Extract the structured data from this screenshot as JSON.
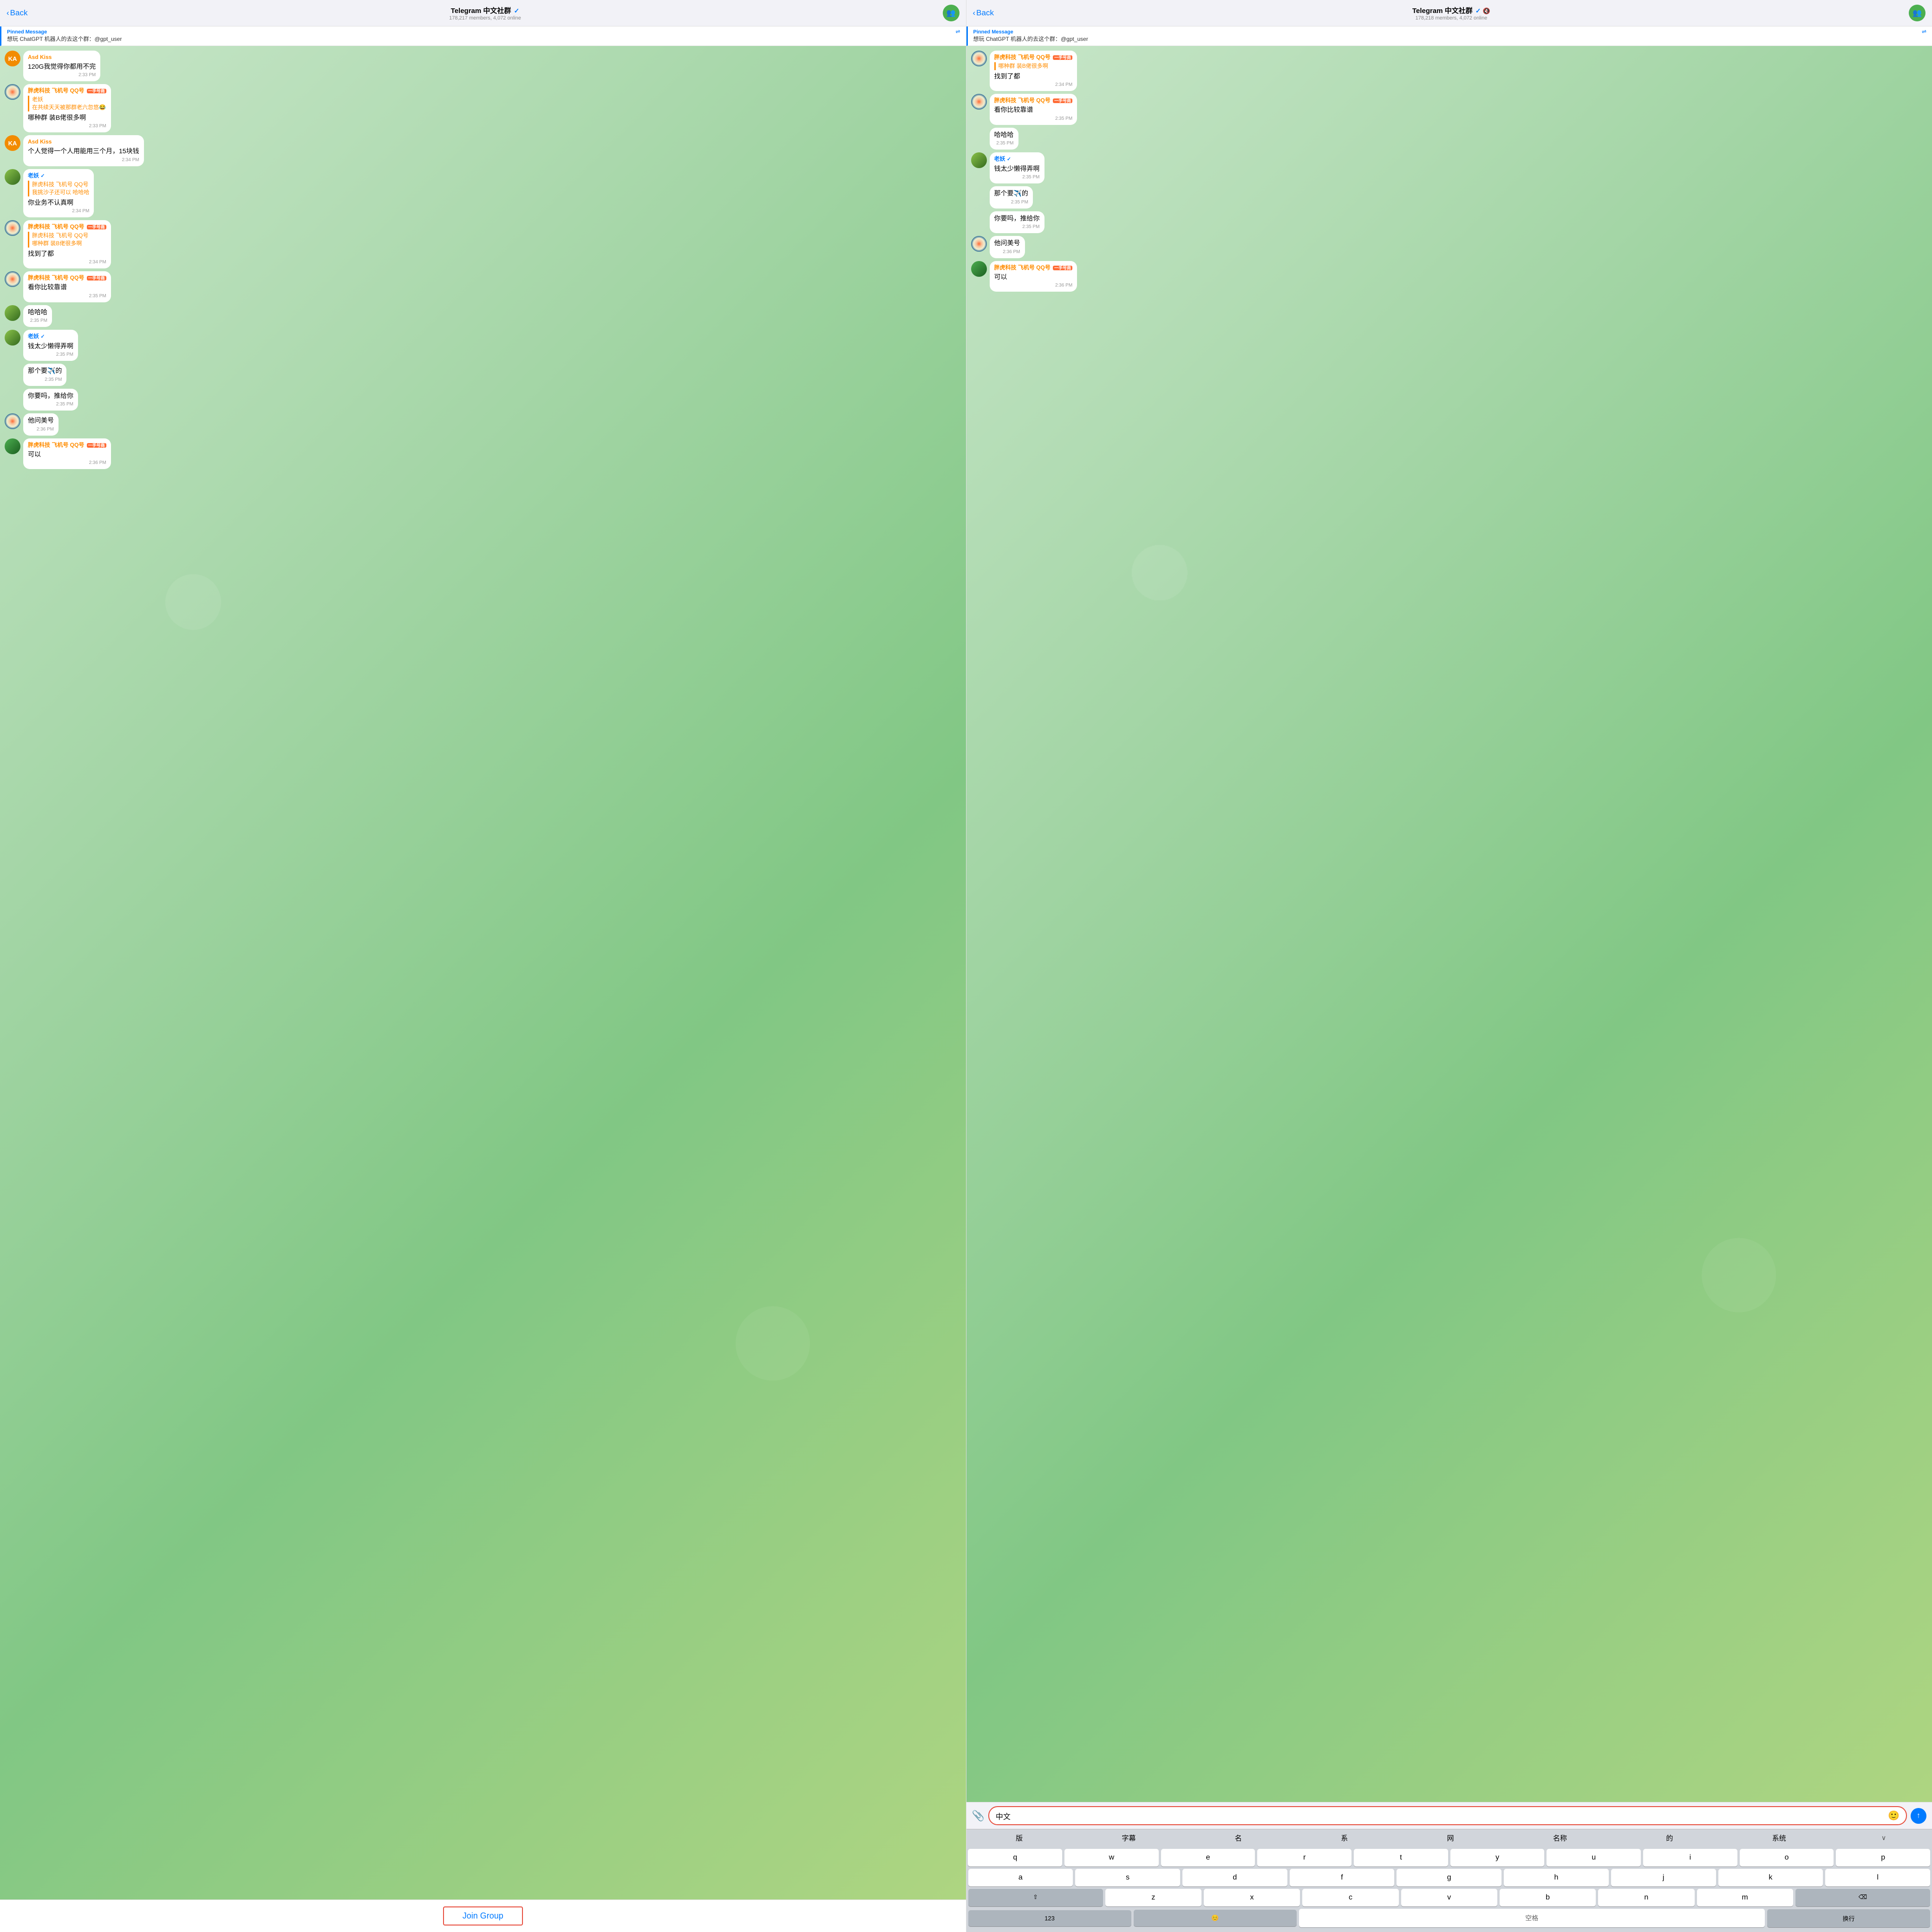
{
  "left_panel": {
    "header": {
      "back_label": "Back",
      "title": "Telegram 中文社群",
      "verified": true,
      "subtitle": "178,217 members, 4,072 online"
    },
    "pinned": {
      "label": "Pinned Message",
      "text": "想玩 ChatGPT 机器人的去这个群：@gpt_user"
    },
    "messages": [
      {
        "id": "m1",
        "avatar": "KA",
        "avatar_type": "ka",
        "sender": "Asd Kiss",
        "sender_color": "orange",
        "text": "120G我觉得你都用不完",
        "time": "2:33 PM"
      },
      {
        "id": "m2",
        "avatar": "deco",
        "avatar_type": "deco",
        "sender": "胖虎科技 飞机号 QQ号",
        "sender_color": "orange",
        "badge": true,
        "quote": "老妖",
        "quote_text": "在共续天天被那群老六忽悠😂",
        "text": "哪种群 装B佬很多啊",
        "time": "2:33 PM"
      },
      {
        "id": "m3",
        "avatar": "KA",
        "avatar_type": "ka",
        "sender": "Asd Kiss",
        "sender_color": "orange",
        "text": "个人觉得一个人用能用三个月，15块钱",
        "time": "2:34 PM"
      },
      {
        "id": "m4",
        "avatar": "verified",
        "avatar_type": "photo",
        "sender": "老妖",
        "sender_color": "blue",
        "verified": true,
        "quote": "胖虎科技 飞机号 QQ号",
        "quote_text": "我挑沙子还可以 哈哈哈",
        "text": "你业务不认真啊",
        "time": "2:34 PM"
      },
      {
        "id": "m5",
        "avatar": "deco",
        "avatar_type": "deco",
        "sender": "胖虎科技 飞机号 QQ号",
        "sender_color": "orange",
        "badge": true,
        "quote": "胖虎科技 飞机号 QQ号",
        "quote_text": "哪种群 装B佬很多啊",
        "text": "找到了都",
        "time": "2:34 PM"
      },
      {
        "id": "m6",
        "avatar": "deco",
        "avatar_type": "deco",
        "sender": "胖虎科技 飞机号 QQ号",
        "sender_color": "orange",
        "badge": true,
        "text": "看你比较靠谱",
        "time": "2:35 PM"
      },
      {
        "id": "m7",
        "avatar": null,
        "text": "哈哈哈",
        "time": "2:35 PM",
        "no_sender": true
      },
      {
        "id": "m8",
        "avatar": "verified",
        "avatar_type": "photo",
        "sender": "老妖",
        "sender_color": "blue",
        "verified": true,
        "text": "钱太少懒得弄啊",
        "time": "2:35 PM"
      },
      {
        "id": "m9",
        "avatar": null,
        "text": "那个要✈️的",
        "time": "2:35 PM",
        "no_sender": true
      },
      {
        "id": "m10",
        "avatar": null,
        "text": "你要吗，推给你",
        "time": "2:35 PM",
        "no_sender": true
      },
      {
        "id": "m11",
        "avatar": "deco",
        "avatar_type": "deco",
        "text": "他问美号",
        "time": "2:36 PM",
        "no_sender": true
      },
      {
        "id": "m12",
        "avatar": "deco",
        "avatar_type": "deco2",
        "sender": "胖虎科技 飞机号 QQ号",
        "sender_color": "orange",
        "badge": true,
        "text": "可以",
        "time": "2:36 PM"
      }
    ],
    "join_button": "Join Group"
  },
  "right_panel": {
    "header": {
      "back_label": "Back",
      "title": "Telegram 中文社群",
      "verified": true,
      "muted": true,
      "subtitle": "178,218 members, 4,072 online"
    },
    "pinned": {
      "label": "Pinned Message",
      "text": "想玩 ChatGPT 机器人的去这个群：@gpt_user"
    },
    "messages": [
      {
        "id": "r1",
        "avatar": "deco",
        "sender": "胖虎科技 飞机号 QQ号",
        "sender_color": "orange",
        "badge": true,
        "quote": "哪种群 装B佬很多啊",
        "text": "找到了都",
        "time": "2:34 PM"
      },
      {
        "id": "r2",
        "avatar": "deco",
        "sender": "胖虎科技 飞机号 QQ号",
        "sender_color": "orange",
        "badge": true,
        "text": "看你比较靠谱",
        "time": "2:35 PM"
      },
      {
        "id": "r3",
        "text": "哈哈哈",
        "time": "2:35 PM",
        "no_sender": true
      },
      {
        "id": "r4",
        "avatar": "photo",
        "sender": "老妖",
        "sender_color": "blue",
        "verified": true,
        "text": "钱太少懒得弄啊",
        "time": "2:35 PM"
      },
      {
        "id": "r5",
        "text": "那个要✈️的",
        "time": "2:35 PM",
        "no_sender": true
      },
      {
        "id": "r6",
        "text": "你要吗，推给你",
        "time": "2:35 PM",
        "no_sender": true
      },
      {
        "id": "r7",
        "avatar": "deco",
        "text": "他问美号",
        "time": "2:36 PM",
        "no_sender": true
      },
      {
        "id": "r8",
        "avatar": "deco2",
        "sender": "胖虎科技 飞机号 QQ号",
        "sender_color": "orange",
        "badge": true,
        "text": "可以",
        "time": "2:36 PM"
      }
    ],
    "input": {
      "placeholder": "",
      "value": "中文",
      "attach_icon": "📎",
      "emoji_icon": "🙂",
      "send_icon": "↑"
    },
    "suggestions": [
      "版",
      "字幕",
      "名",
      "系",
      "网",
      "名称",
      "的",
      "系统"
    ],
    "keyboard": {
      "rows": [
        [
          "q",
          "w",
          "e",
          "r",
          "t",
          "y",
          "u",
          "i",
          "o",
          "p"
        ],
        [
          "a",
          "s",
          "d",
          "f",
          "g",
          "h",
          "j",
          "k",
          "l"
        ],
        [
          "z",
          "x",
          "c",
          "v",
          "b",
          "n",
          "m"
        ],
        [
          "123",
          "😊",
          "空格",
          "换行"
        ]
      ]
    }
  }
}
